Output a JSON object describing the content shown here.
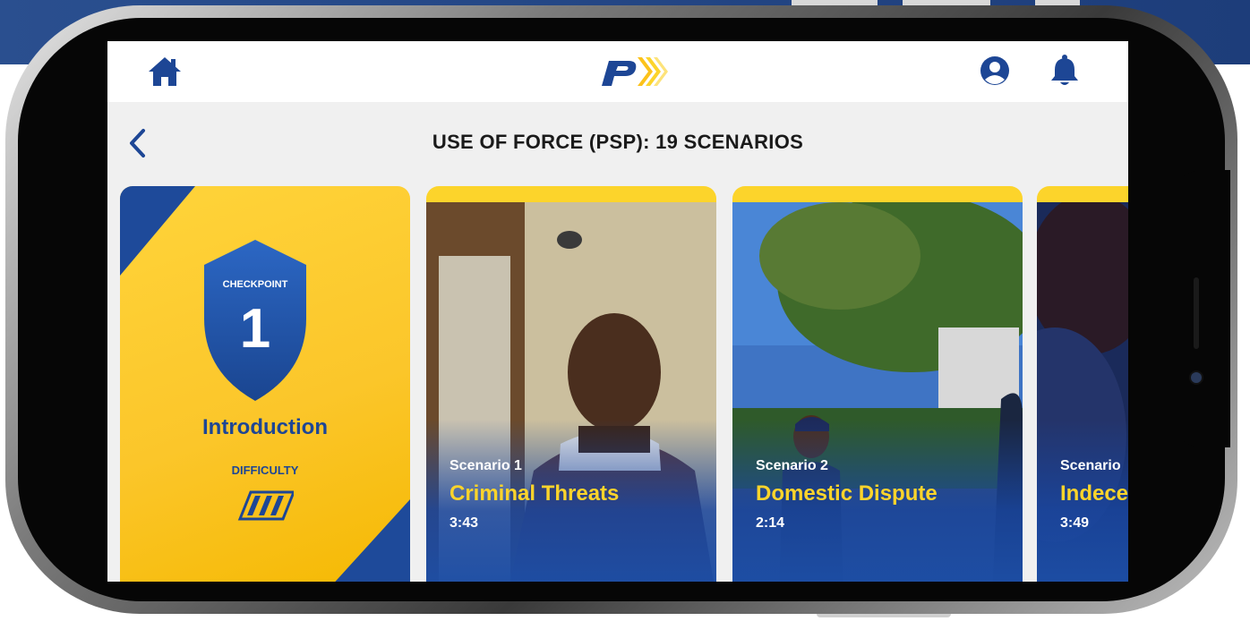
{
  "header": {
    "home_icon": "home-icon",
    "logo_letter": "P",
    "user_icon": "user-circle-icon",
    "bell_icon": "bell-icon"
  },
  "page": {
    "title": "USE OF FORCE (PSP): 19 SCENARIOS",
    "back_icon": "chevron-left-icon"
  },
  "checkpoint": {
    "label": "CHECKPOINT",
    "number": "1",
    "title": "Introduction",
    "difficulty_label": "DIFFICULTY"
  },
  "scenarios": [
    {
      "number": "Scenario 1",
      "title": "Criminal Threats",
      "duration": "3:43"
    },
    {
      "number": "Scenario 2",
      "title": "Domestic Dispute",
      "duration": "2:14"
    },
    {
      "number": "Scenario",
      "title": "Indecent",
      "duration": "3:49"
    }
  ],
  "colors": {
    "brand_blue": "#1d4695",
    "brand_yellow": "#fcd42b"
  }
}
